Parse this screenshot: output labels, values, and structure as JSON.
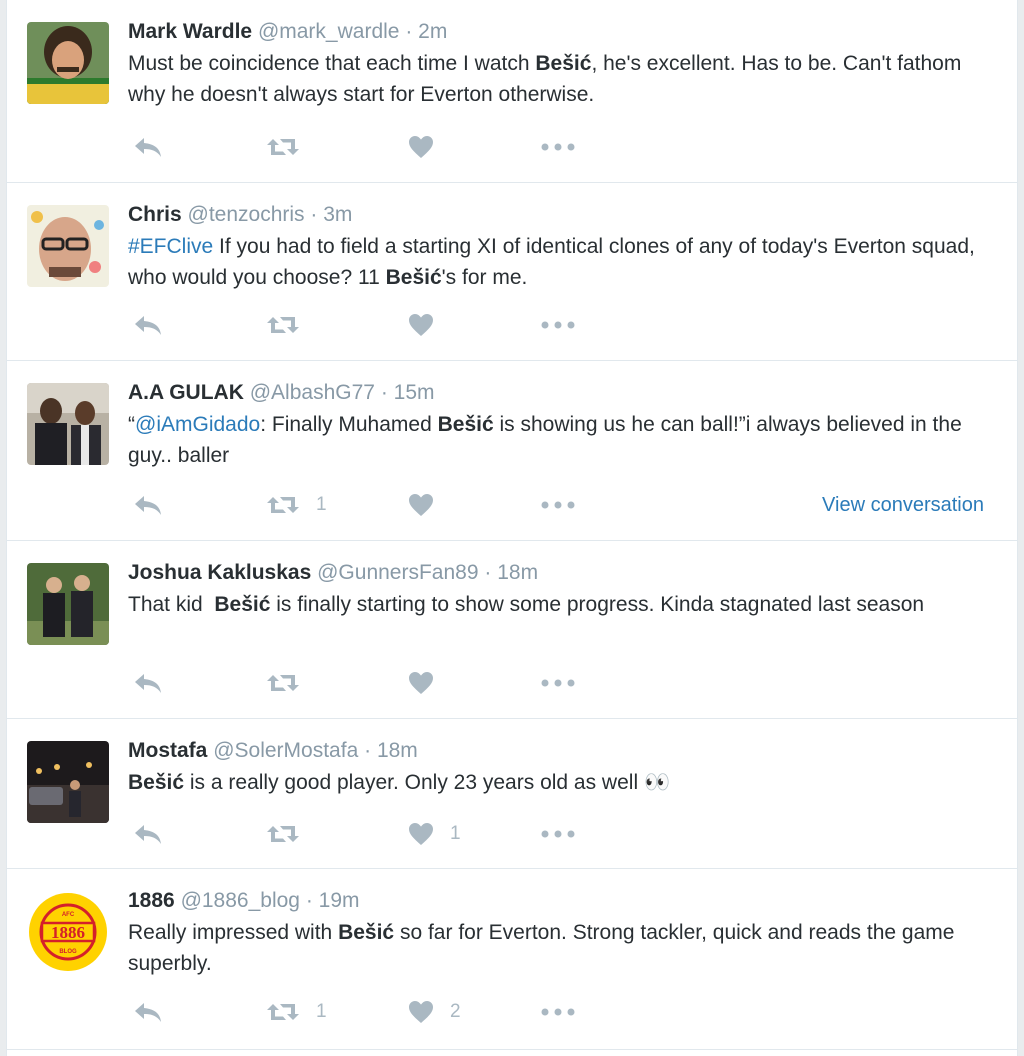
{
  "tweets": [
    {
      "fullname": "Mark Wardle",
      "username": "@mark_wardle",
      "time": "2m",
      "text_a": "Must be coincidence that each time I watch ",
      "bold": "Bešić",
      "text_b": ", he's excellent. Has to be. Can't fathom why he doesn't always start for Everton otherwise.",
      "retweets": "",
      "likes": ""
    },
    {
      "fullname": "Chris",
      "username": "@tenzochris",
      "time": "3m",
      "hashtag": "#EFClive",
      "text_a": " If you had to field a starting XI of identical clones of any of today's Everton squad, who would you choose? 11 ",
      "bold": "Bešić",
      "text_b": "'s for me.",
      "retweets": "",
      "likes": ""
    },
    {
      "fullname": "A.A GULAK",
      "username": "@AlbashG77",
      "time": "15m",
      "text_pre": "“",
      "mention": "@iAmGidado",
      "text_a": ": Finally Muhamed ",
      "bold": "Bešić",
      "text_b": " is showing us he can ball!”i always believed in the guy.. baller",
      "retweets": "1",
      "likes": "",
      "view_conversation": "View conversation"
    },
    {
      "fullname": "Joshua Kakluskas",
      "username": "@GunnersFan89",
      "time": "18m",
      "text_a": "That kid  ",
      "bold": "Bešić",
      "text_b": " is finally starting to show some progress. Kinda stagnated last season",
      "retweets": "",
      "likes": ""
    },
    {
      "fullname": "Mostafa",
      "username": "@SolerMostafa",
      "time": "18m",
      "bold": "Bešić",
      "text_b": " is a really good player. Only 23 years old as well 👀",
      "retweets": "",
      "likes": "1"
    },
    {
      "fullname": "1886",
      "username": "@1886_blog",
      "time": "19m",
      "text_a": "Really impressed with ",
      "bold": "Bešić",
      "text_b": " so far for Everton. Strong tackler, quick and reads the game superbly.",
      "retweets": "1",
      "likes": "2",
      "logo": {
        "top": "AFC",
        "mid": "1886",
        "bot": "BLOG"
      }
    }
  ],
  "colors": {
    "link": "#2b7bb9",
    "muted": "#8899a6",
    "icon": "#aab8c2",
    "logo_yellow": "#ffd200",
    "logo_red": "#d4202a"
  }
}
